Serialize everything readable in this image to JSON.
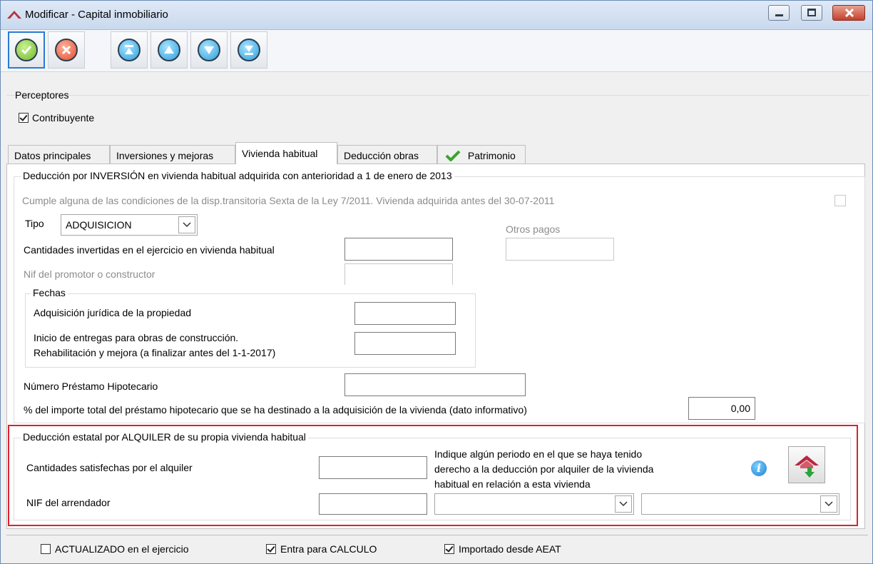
{
  "window": {
    "title": "Modificar - Capital inmobiliario",
    "logo_icon": "app-roof-logo-icon"
  },
  "toolbar": {
    "buttons": [
      {
        "name": "accept",
        "icon": "check-circle-icon",
        "color": "#7bc043"
      },
      {
        "name": "cancel",
        "icon": "x-circle-icon",
        "color": "#e8553a"
      },
      {
        "name": "first",
        "icon": "arrow-first-icon",
        "color": "#3aa7e0"
      },
      {
        "name": "previous",
        "icon": "arrow-up-icon",
        "color": "#3aa7e0"
      },
      {
        "name": "next",
        "icon": "arrow-down-icon",
        "color": "#3aa7e0"
      },
      {
        "name": "last",
        "icon": "arrow-last-icon",
        "color": "#3aa7e0"
      }
    ]
  },
  "perceptores": {
    "legend": "Perceptores",
    "contribuyente_label": "Contribuyente",
    "contribuyente_checked": true
  },
  "tabs": [
    {
      "label": "Datos principales",
      "active": false
    },
    {
      "label": "Inversiones y mejoras",
      "active": false
    },
    {
      "label": "Vivienda habitual",
      "active": true
    },
    {
      "label": "Deducción obras",
      "active": false
    },
    {
      "label": "Patrimonio",
      "active": false,
      "icon": "green-check-icon"
    }
  ],
  "inversion": {
    "legend": "Deducción por INVERSIÓN en vivienda habitual adquirida con anterioridad a 1 de enero de 2013",
    "cumple_label": "Cumple alguna de las condiciones de la disp.transitoria Sexta de la Ley 7/2011. Vivienda adquirida antes del 30-07-2011",
    "tipo_label": "Tipo",
    "tipo_value": "ADQUISICION",
    "otros_pagos_label": "Otros pagos",
    "cantidades_label": "Cantidades invertidas en el ejercicio en vivienda habitual",
    "nif_promotor_label": "Nif del promotor o constructor",
    "fechas": {
      "legend": "Fechas",
      "adquisicion_label": "Adquisición jurídica de la propiedad",
      "inicio_label_1": "Inicio de entregas para obras de construcción.",
      "inicio_label_2": "Rehabilitación y mejora (a finalizar antes del 1-1-2017)"
    },
    "prestamo_label": "Número Préstamo Hipotecario",
    "porcentaje_label": "% del importe total del préstamo hipotecario que se ha destinado a la adquisición de la vivienda (dato informativo)",
    "porcentaje_value": "0,00"
  },
  "alquiler": {
    "legend": "Deducción estatal por ALQUILER de su propia vivienda habitual",
    "cantidades_label": "Cantidades satisfechas por el alquiler",
    "nif_label": "NIF del arrendador",
    "periodo_text_1": "Indique algún periodo en el que se haya tenido",
    "periodo_text_2": "derecho a la deducción por alquiler de la vivienda",
    "periodo_text_3": "habitual en relación a esta vivienda",
    "highlight_color": "#d9232e"
  },
  "footer": {
    "actualizado_label": "ACTUALIZADO en el ejercicio",
    "actualizado_checked": false,
    "calculo_label": "Entra para CALCULO",
    "calculo_checked": true,
    "aeat_label": "Importado desde AEAT",
    "aeat_checked": true
  }
}
